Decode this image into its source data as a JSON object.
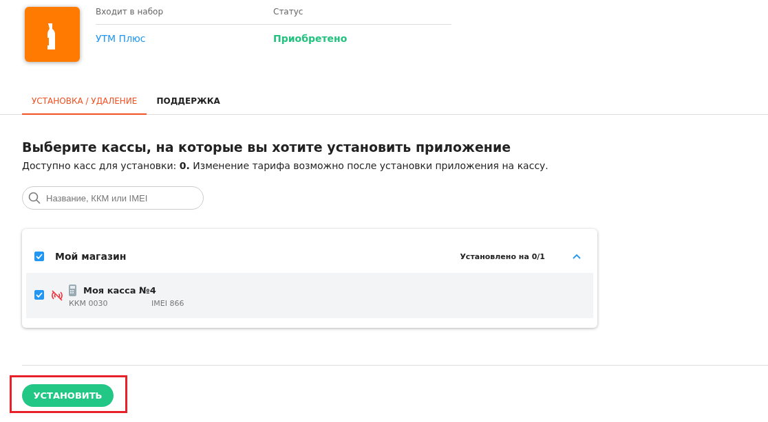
{
  "app": {
    "set_label": "Входит в набор",
    "set_value": "УТМ Плюс",
    "status_label": "Статус",
    "status_value": "Приобретено"
  },
  "tabs": [
    {
      "label": "УСТАНОВКА / УДАЛЕНИЕ",
      "selected": true
    },
    {
      "label": "ПОДДЕРЖКА",
      "selected": false
    }
  ],
  "heading": "Выберите кассы, на которые вы хотите установить приложение",
  "description": "Доступно касс для установки: **0.** Изменение тарифа возможно после установки приложения на кассу.",
  "search": {
    "placeholder": "Название, ККМ или IMEI"
  },
  "store": {
    "name": "Мой магазин",
    "checked": true,
    "expanded": true,
    "installed": "Установлено на 0/1",
    "registers": [
      {
        "name": "Моя касса №4",
        "checked": true,
        "kkm": "ККМ 0030",
        "imei": "IMEI 866"
      }
    ]
  },
  "install_button": "УСТАНОВИТЬ"
}
